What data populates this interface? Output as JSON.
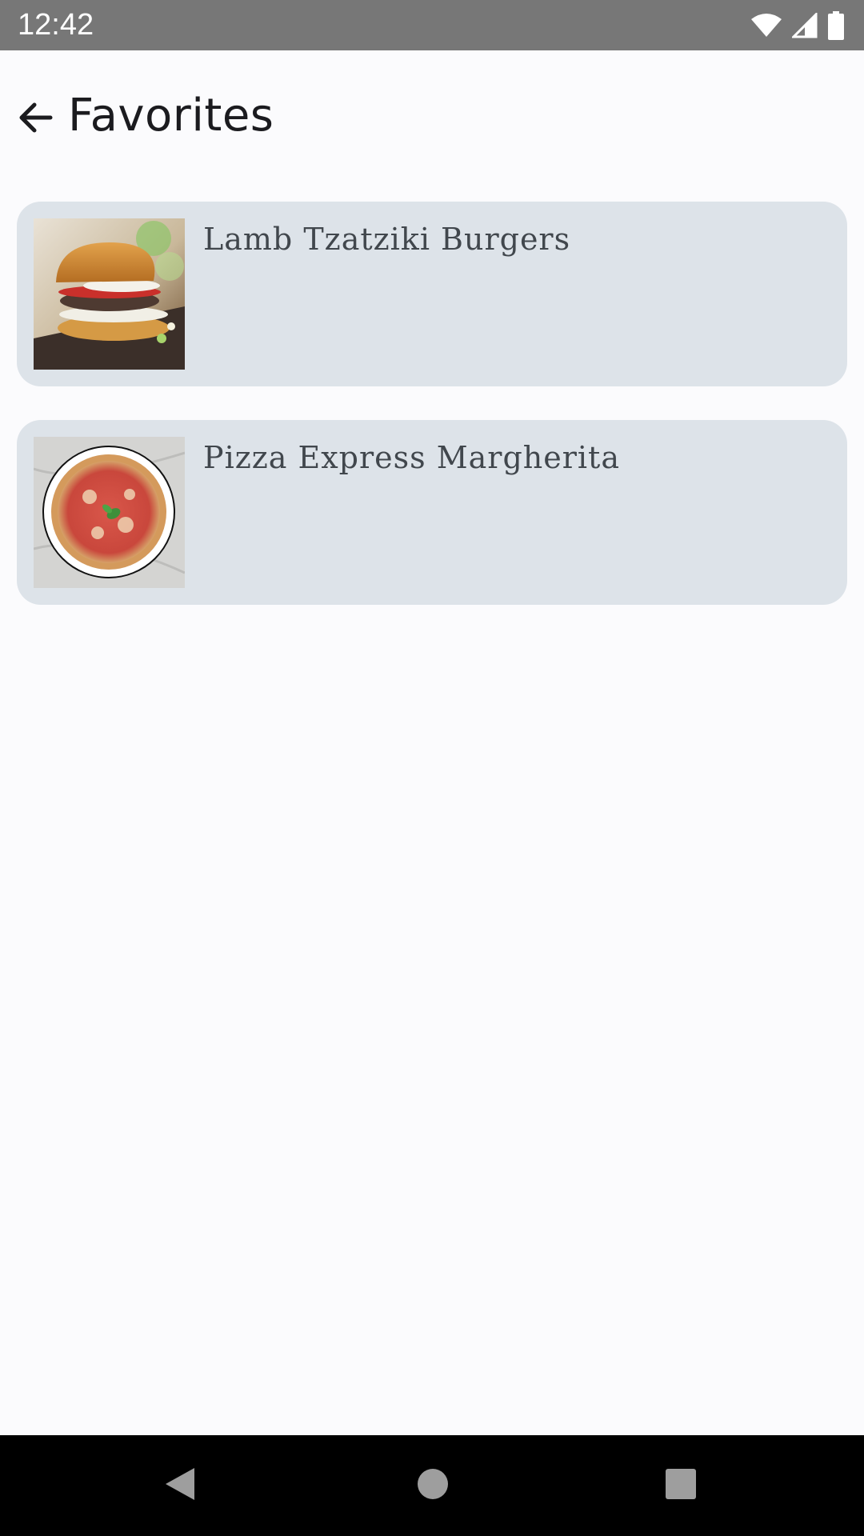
{
  "status_bar": {
    "time": "12:42",
    "icons": [
      "wifi-icon",
      "cellular-signal-icon",
      "battery-icon"
    ]
  },
  "app_bar": {
    "title": "Favorites",
    "back_icon": "arrow-back-icon"
  },
  "favorites": [
    {
      "title": "Lamb Tzatziki Burgers",
      "image": "burger-photo"
    },
    {
      "title": "Pizza Express Margherita",
      "image": "pizza-photo"
    }
  ],
  "nav_bar": {
    "buttons": [
      "back-triangle-icon",
      "home-circle-icon",
      "recents-square-icon"
    ]
  },
  "colors": {
    "status_bar": "#777777",
    "background": "#fbfbfd",
    "card": "#dde3e9",
    "card_text": "#41474d",
    "title_text": "#1b1b1f",
    "nav_bar": "#000000"
  }
}
